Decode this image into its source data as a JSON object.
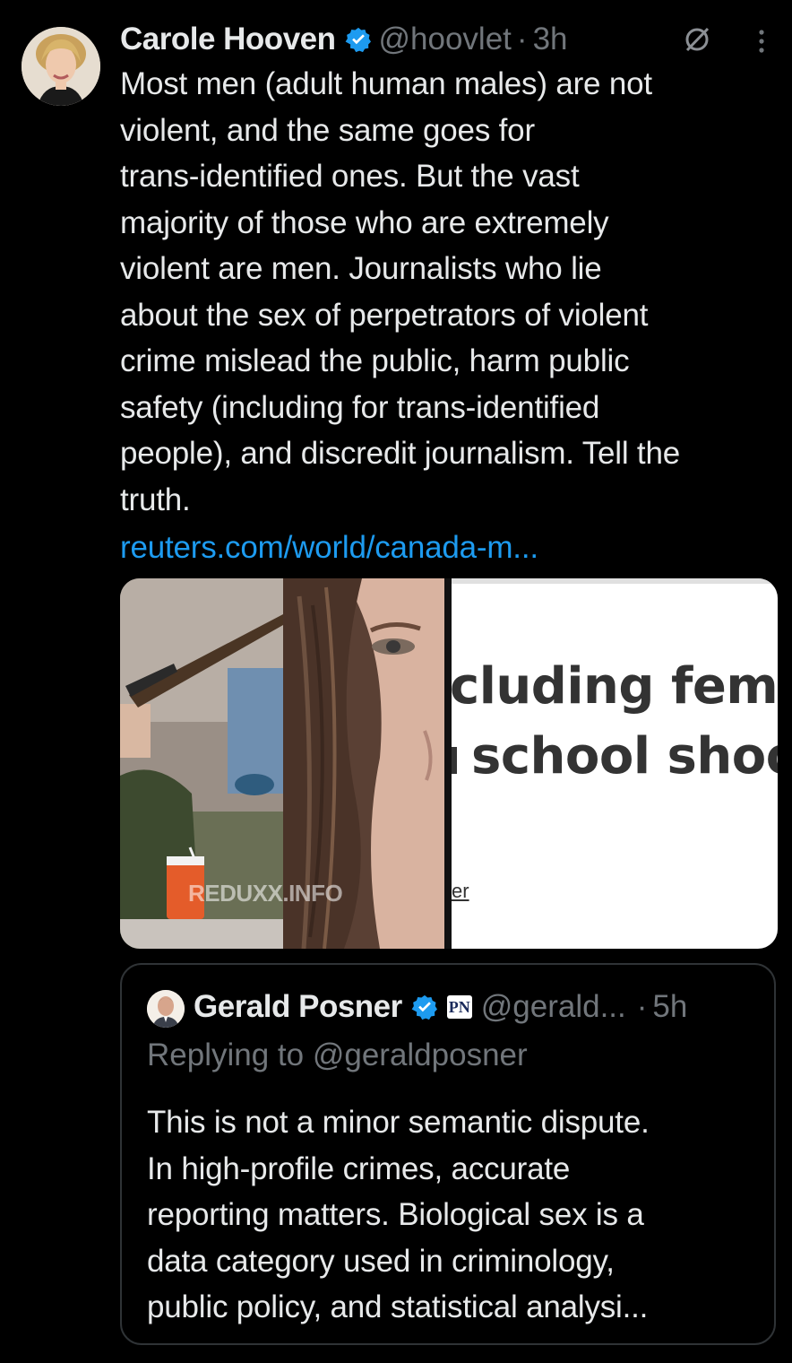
{
  "tweet": {
    "author": {
      "display_name": "Carole Hooven",
      "handle": "@hoovlet",
      "avatar_icon": "profile-photo",
      "verified_color": "#1d9bf0"
    },
    "time": "3h",
    "separator": "·",
    "text": "Most men (adult human males) are not\nviolent, and the same goes for\ntrans-identified ones. But the vast\nmajority of those who are extremely\nviolent are men.  Journalists who lie\nabout the sex of perpetrators of violent\ncrime mislead the public, harm public\nsafety (including for trans-identified\npeople), and discredit journalism. Tell the\ntruth.",
    "link": "reuters.com/world/canada-m...",
    "media": {
      "watermark": "REDUXX.INFO",
      "headline_line1": "cluding femal",
      "headline_line2": "school shoot",
      "footer_fragment": "er"
    }
  },
  "quote": {
    "author": {
      "display_name": "Gerald Posner",
      "handle": "@gerald...",
      "affiliate_badge": "PN"
    },
    "time": "5h",
    "separator": "·",
    "replying_to": "Replying to @geraldposner",
    "text": "This is not a minor semantic dispute.\nIn high-profile crimes, accurate\nreporting matters. Biological sex is a\ndata category used in criminology,\npublic policy, and statistical analysi..."
  },
  "colors": {
    "background": "#000000",
    "text_primary": "#e7e9ea",
    "text_secondary": "#71767b",
    "link": "#1d9bf0",
    "border": "#2f3336"
  }
}
